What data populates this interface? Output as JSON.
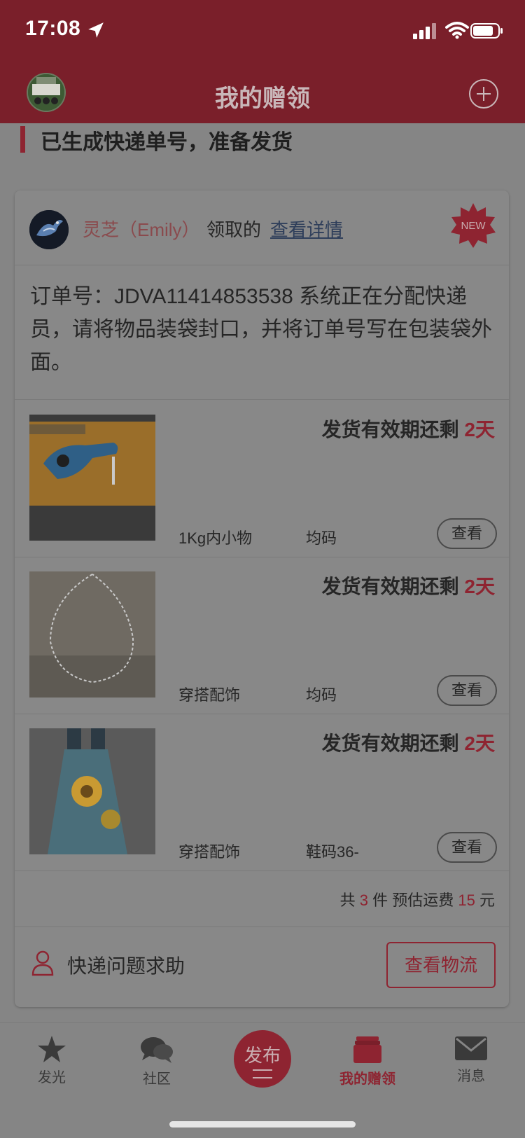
{
  "status_bar": {
    "time": "17:08"
  },
  "nav": {
    "title": "我的赠领"
  },
  "section_title": "已生成快递单号，准备发货",
  "card": {
    "user_name": "灵芝（Emily）",
    "claimed_text": "领取的",
    "details_link": "查看详情",
    "new_badge": "NEW",
    "order_message": "订单号：JDVA11414853538 系统正在分配快递员，请将物品装袋封口，并将订单号写在包装袋外面。",
    "items": [
      {
        "expiry_prefix": "发货有效期还剩",
        "expiry_days": "2天",
        "category": "1Kg内小物",
        "size": "均码",
        "view_label": "查看"
      },
      {
        "expiry_prefix": "发货有效期还剩",
        "expiry_days": "2天",
        "category": "穿搭配饰",
        "size": "均码",
        "view_label": "查看"
      },
      {
        "expiry_prefix": "发货有效期还剩",
        "expiry_days": "2天",
        "category": "穿搭配饰",
        "size": "鞋码36-",
        "view_label": "查看"
      }
    ],
    "summary": {
      "prefix": "共",
      "count": "3",
      "count_unit": "件 预估运费",
      "fee": "15",
      "fee_unit": "元"
    },
    "help_text": "快递问题求助",
    "logistics_button": "查看物流"
  },
  "tabs": [
    {
      "label": "发光",
      "icon": "star-icon"
    },
    {
      "label": "社区",
      "icon": "chat-icon"
    },
    {
      "label": "发布",
      "icon": "publish-icon"
    },
    {
      "label": "我的赠领",
      "icon": "gift-box-icon",
      "active": true
    },
    {
      "label": "消息",
      "icon": "mail-icon"
    }
  ],
  "colors": {
    "accent": "#8e2431",
    "header": "#7a1f2a",
    "overlay_bg": "#858585"
  }
}
